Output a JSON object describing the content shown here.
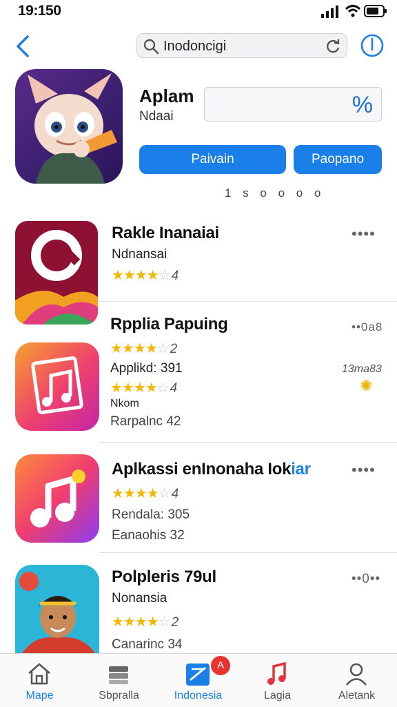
{
  "status": {
    "time": "19:150"
  },
  "header": {
    "search_placeholder": "Inodoncigi"
  },
  "hero": {
    "title": "Aplam",
    "subtitle": "Ndaai",
    "box_value": "%",
    "primary_button": "Paivain",
    "secondary_button": "Paopano",
    "pager": "1 s o o o o"
  },
  "apps": [
    {
      "title": "Rakle Inanaiai",
      "subtitle": "Ndnansai",
      "stars": 4,
      "rating": "4",
      "more": "••••"
    },
    {
      "title": "Rpplia Papuing",
      "stars_a": 4,
      "rating_a": "2",
      "line1": "Applikd: 391",
      "stars_b": 4,
      "rating_b": "4",
      "line2": "Nkom",
      "line3": "Rarpalnc 42",
      "more": "••0a8",
      "side_label": "13ma83"
    },
    {
      "title_a": "Aplkassi enInonaha Iok",
      "title_b": "iar",
      "stars": 4,
      "rating": "4",
      "line1": "Rendala: 305",
      "line2": "Eanaohis 32",
      "more": "••••"
    },
    {
      "title": "Polpleris 79ul",
      "subtitle": "Nonansia",
      "stars": 4,
      "rating": "2",
      "line1": "Canarinc 34",
      "more": "••0••"
    }
  ],
  "tabs": [
    {
      "label": "Mape",
      "icon": "home-icon",
      "active": true
    },
    {
      "label": "Sbpralla",
      "icon": "stack-icon",
      "active": false
    },
    {
      "label": "Indonesia",
      "icon": "apps-icon",
      "active": true
    },
    {
      "label": "Lagia",
      "icon": "music-icon",
      "active": false
    },
    {
      "label": "Aletank",
      "icon": "person-icon",
      "active": false
    }
  ],
  "badge": "A",
  "colors": {
    "accent": "#1a7fe8",
    "star": "#f5b800",
    "badge": "#e8322e"
  }
}
